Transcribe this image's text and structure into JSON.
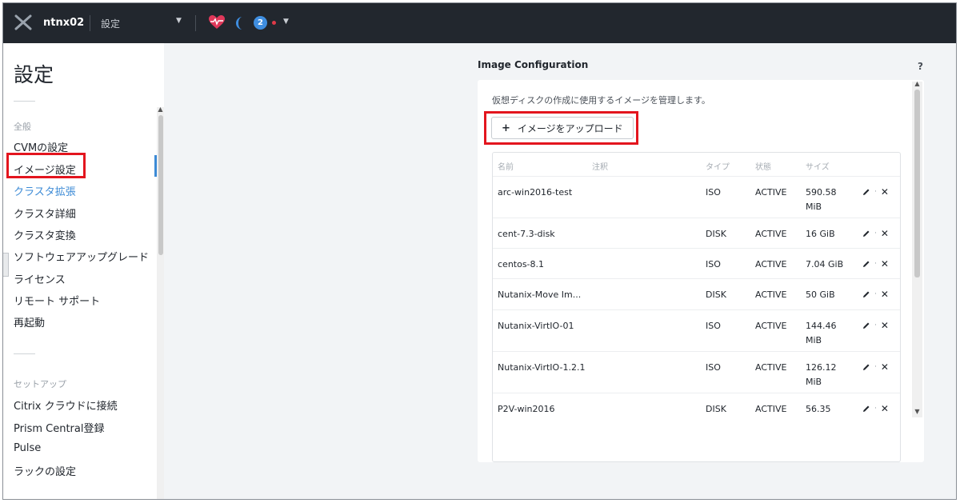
{
  "topbar": {
    "cluster_name": "ntnx02",
    "page_select": "設定",
    "alerts_count": "2",
    "colors": {
      "background": "#22272e",
      "health": "#e0385a",
      "badge": "#3f8ee0",
      "alert_dot": "#e03a48"
    }
  },
  "sidebar": {
    "title": "設定",
    "section_general": "全般",
    "general_items": [
      {
        "label": "CVMの設定"
      },
      {
        "label": "イメージ設定"
      },
      {
        "label": "クラスタ拡張"
      },
      {
        "label": "クラスタ詳細"
      },
      {
        "label": "クラスタ変換"
      },
      {
        "label": "ソフトウェアアップグレード"
      },
      {
        "label": "ライセンス"
      },
      {
        "label": "リモート サポート"
      },
      {
        "label": "再起動"
      }
    ],
    "section_setup": "セットアップ",
    "setup_items": [
      {
        "label": "Citrix クラウドに接続"
      },
      {
        "label": "Prism Central登録"
      },
      {
        "label": "Pulse"
      },
      {
        "label": "ラックの設定"
      }
    ],
    "active_item": "イメージ設定"
  },
  "panel": {
    "heading": "Image Configuration",
    "help": "?",
    "description": "仮想ディスクの作成に使用するイメージを管理します。",
    "upload_button": "イメージをアップロード",
    "columns": [
      "名前",
      "注釈",
      "タイプ",
      "状態",
      "サイズ"
    ],
    "rows": [
      {
        "name": "arc-win2016-test",
        "type": "ISO",
        "state": "ACTIVE",
        "size": "590.58 MiB"
      },
      {
        "name": "cent-7.3-disk",
        "type": "DISK",
        "state": "ACTIVE",
        "size": "16 GiB"
      },
      {
        "name": "centos-8.1",
        "type": "ISO",
        "state": "ACTIVE",
        "size": "7.04 GiB"
      },
      {
        "name": "Nutanix-Move Im...",
        "type": "DISK",
        "state": "ACTIVE",
        "size": "50 GiB"
      },
      {
        "name": "Nutanix-VirtIO-01",
        "type": "ISO",
        "state": "ACTIVE",
        "size": "144.46 MiB"
      },
      {
        "name": "Nutanix-VirtIO-1.2.1",
        "type": "ISO",
        "state": "ACTIVE",
        "size": "126.12 MiB"
      },
      {
        "name": "P2V-win2016",
        "type": "DISK",
        "state": "ACTIVE",
        "size": "56.35"
      }
    ],
    "action_separator": "·"
  }
}
